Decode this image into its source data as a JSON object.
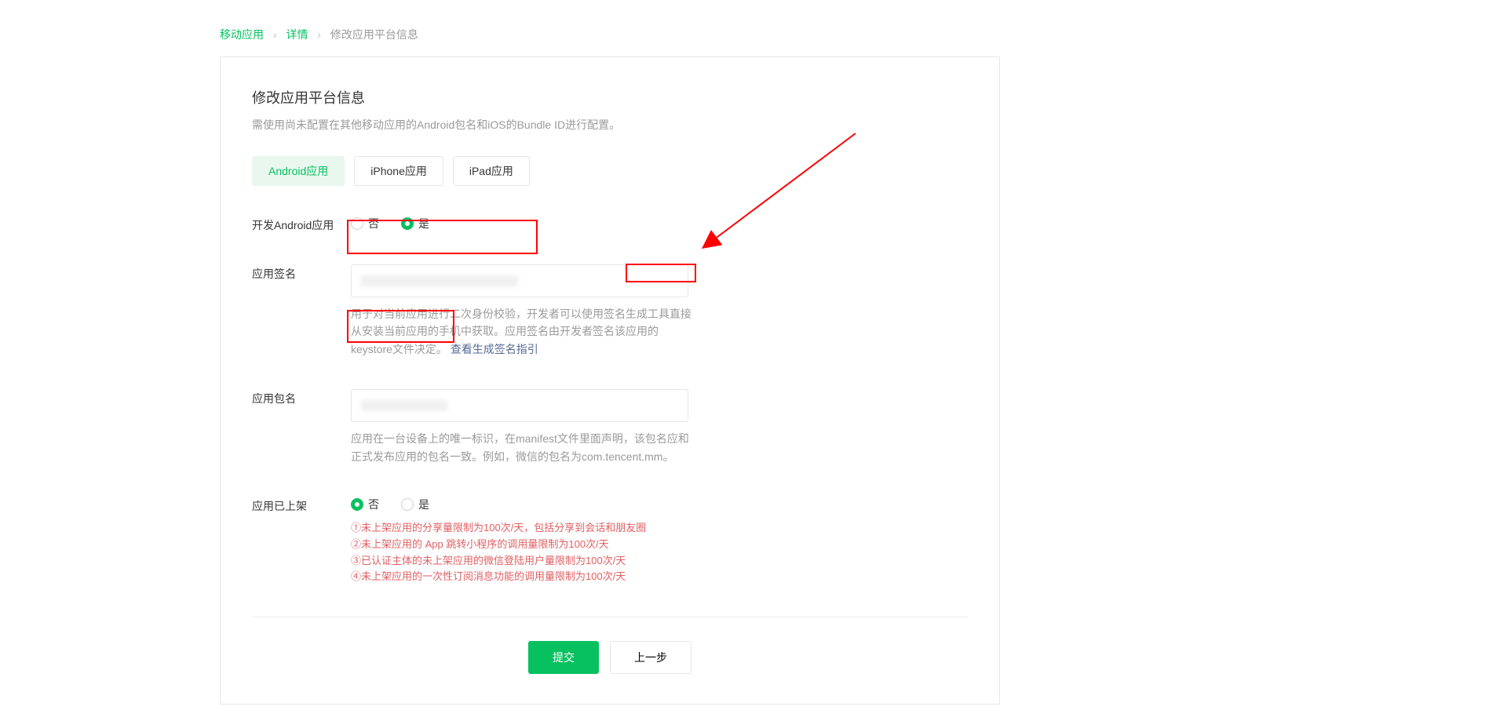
{
  "breadcrumb": {
    "item0": "移动应用",
    "item1": "详情",
    "current": "修改应用平台信息"
  },
  "panel": {
    "title": "修改应用平台信息",
    "subtitle": "需使用尚未配置在其他移动应用的Android包名和iOS的Bundle ID进行配置。"
  },
  "tabs": {
    "android": "Android应用",
    "iphone": "iPhone应用",
    "ipad": "iPad应用"
  },
  "form": {
    "dev_android_label": "开发Android应用",
    "radio_no": "否",
    "radio_yes": "是",
    "sign_label": "应用签名",
    "sign_hint_1": "用于对当前应用进行二次身份校验，开发者可以使用签名生成工具直接从安装当前应用的手机中获取。应用签名由开发者签名该应用的keystore文件决定。",
    "sign_link": "查看生成签名指引",
    "pkg_label": "应用包名",
    "pkg_hint": "应用在一台设备上的唯一标识，在manifest文件里面声明，该包名应和正式发布应用的包名一致。例如，微信的包名为com.tencent.mm。",
    "listed_label": "应用已上架",
    "warn1": "①未上架应用的分享量限制为100次/天，包括分享到会话和朋友圈",
    "warn2": "②未上架应用的 App 跳转小程序的调用量限制为100次/天",
    "warn3": "③已认证主体的未上架应用的微信登陆用户量限制为100次/天",
    "warn4": "④未上架应用的一次性订阅消息功能的调用量限制为100次/天"
  },
  "buttons": {
    "submit": "提交",
    "prev": "上一步"
  }
}
